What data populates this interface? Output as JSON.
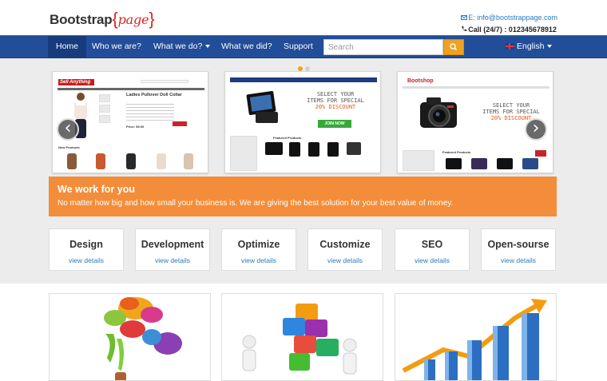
{
  "brand": {
    "name": "Bootstrap",
    "open": "{",
    "page": "page",
    "close": "}"
  },
  "contact": {
    "email": "E: info@bootstrappage.com",
    "phone": "Call (24/7) : 012345678912"
  },
  "nav": {
    "items": [
      {
        "label": "Home",
        "active": true
      },
      {
        "label": "Who we are?"
      },
      {
        "label": "What we do?",
        "dropdown": true
      },
      {
        "label": "What we did?"
      },
      {
        "label": "Support"
      }
    ],
    "search_placeholder": "Search",
    "language": "English"
  },
  "slides": [
    {
      "tag": "Sell Anything",
      "product_title": "Ladies Pullover Doll Collar",
      "price": "Price: $9.00",
      "section": "New Products"
    },
    {
      "promo_line1": "SELECT YOUR",
      "promo_line2": "ITEMS FOR SPECIAL",
      "promo_pct": "20% DISCOUNT",
      "cta": "JOIN NOW",
      "section": "Featured Products"
    },
    {
      "brand": "Bootshop",
      "promo_line1": "SELECT YOUR",
      "promo_line2": "ITEMS FOR SPECIAL",
      "promo_pct": "20% DISCOUNT",
      "section": "Featured Products"
    }
  ],
  "banner": {
    "title": "We work for you",
    "text": "No matter how big and how small your business is. We are giving the best solution for your best value of money."
  },
  "services": [
    {
      "title": "Design",
      "link": "view details"
    },
    {
      "title": "Development",
      "link": "view details"
    },
    {
      "title": "Optimize",
      "link": "view details"
    },
    {
      "title": "Customize",
      "link": "view details"
    },
    {
      "title": "SEO",
      "link": "view details"
    },
    {
      "title": "Open-sourse",
      "link": "view details"
    }
  ],
  "colors": {
    "nav": "#224d99",
    "accent": "#f38d39",
    "search_button": "#f0a120",
    "link": "#2a7ac0",
    "brand_red": "#d9281f"
  },
  "icons": {
    "email": "envelope-icon",
    "phone": "phone-icon",
    "search": "search-icon",
    "prev": "chevron-left-icon",
    "next": "chevron-right-icon"
  }
}
